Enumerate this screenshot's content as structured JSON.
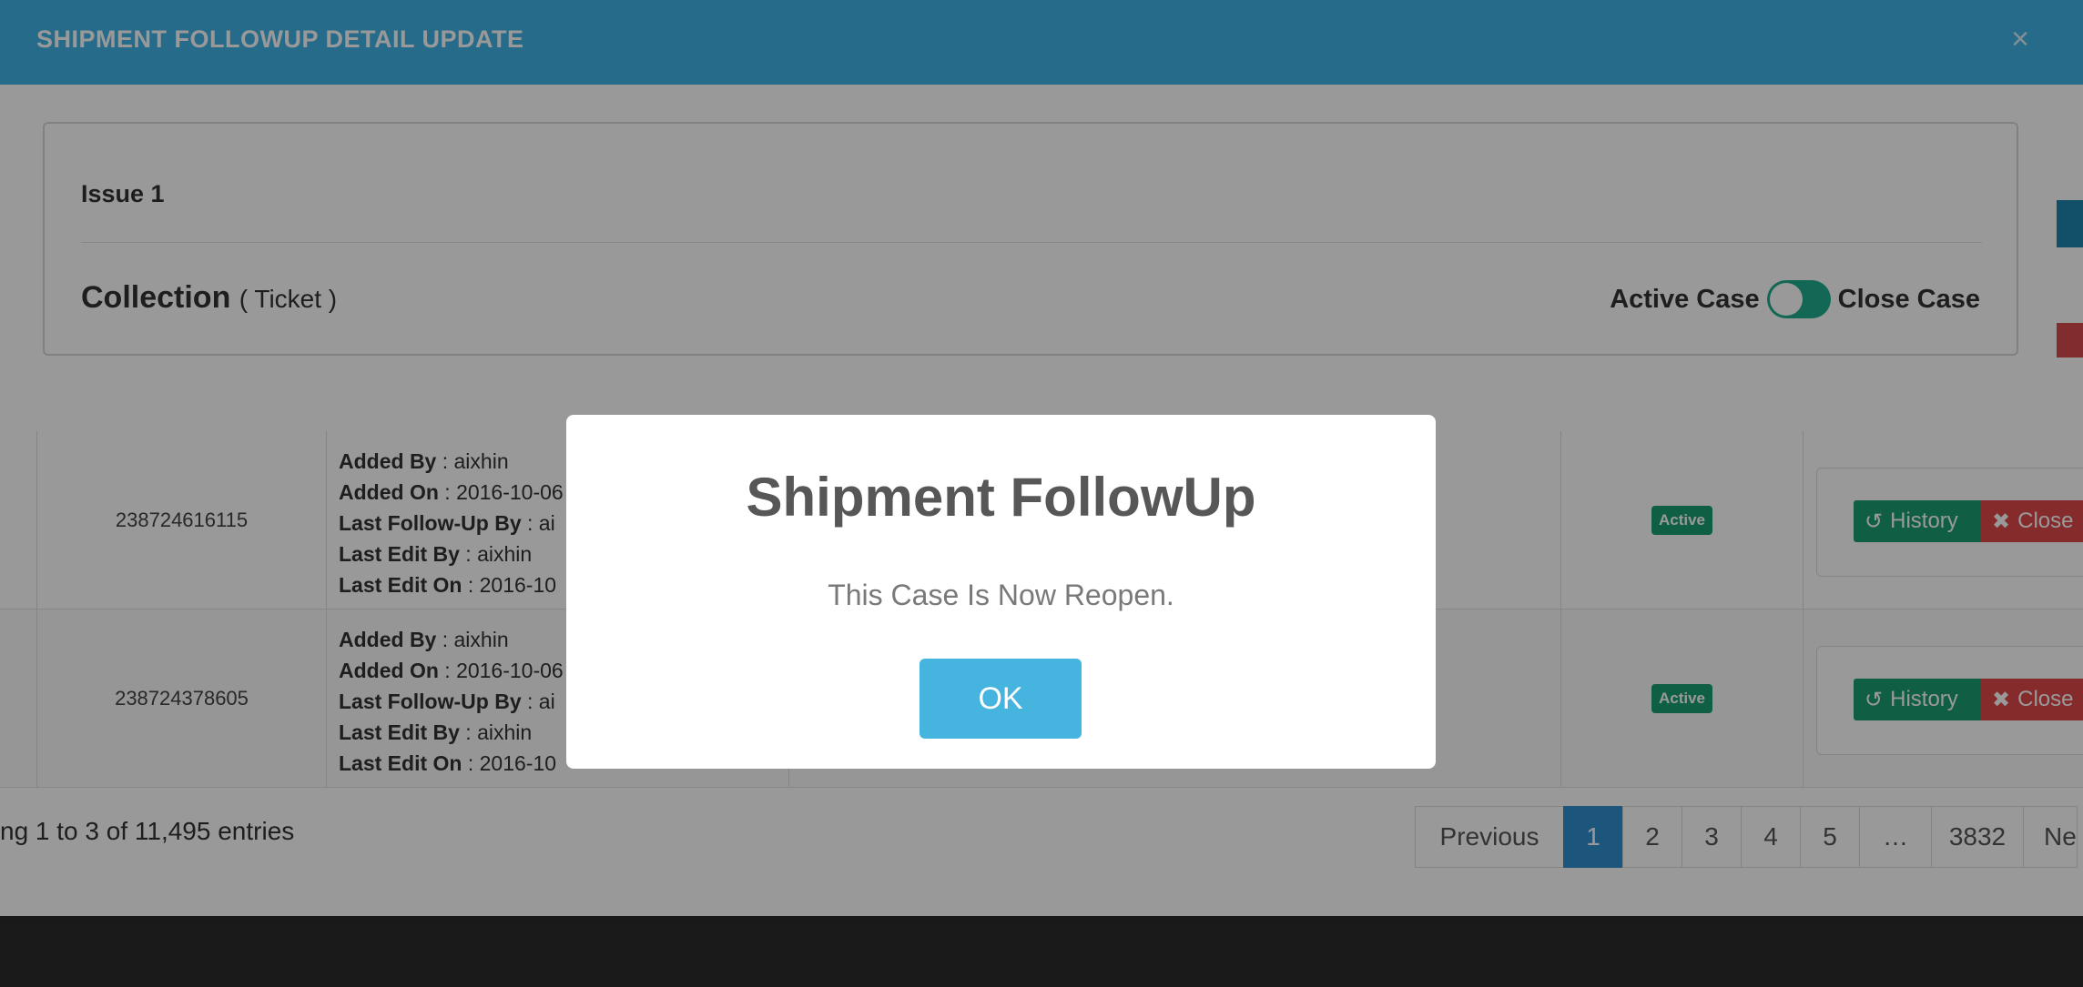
{
  "edit_modal": {
    "title": "SHIPMENT FOLLOWUP DETAIL UPDATE",
    "close_glyph": "×",
    "issue_label": "Issue 1",
    "category": "Collection",
    "category_sub": "( Ticket )",
    "toggle": {
      "left_label": "Active Case",
      "right_label": "Close Case",
      "state": "active"
    }
  },
  "table": {
    "rows": [
      {
        "tracking": "238724616115",
        "added_by_label": "Added By",
        "added_by": "aixhin",
        "added_on_label": "Added On",
        "added_on": "2016-10-06",
        "last_followup_label": "Last Follow-Up By",
        "last_followup": "ai",
        "last_edit_by_label": "Last Edit By",
        "last_edit_by": "aixhin",
        "last_edit_on_label": "Last Edit On",
        "last_edit_on": "2016-10",
        "status": "Active",
        "history_label": "History",
        "close_label": "Close"
      },
      {
        "tracking": "238724378605",
        "added_by_label": "Added By",
        "added_by": "aixhin",
        "added_on_label": "Added On",
        "added_on": "2016-10-06",
        "last_followup_label": "Last Follow-Up By",
        "last_followup": "ai",
        "last_edit_by_label": "Last Edit By",
        "last_edit_by": "aixhin",
        "last_edit_on_label": "Last Edit On",
        "last_edit_on": "2016-10",
        "status": "Active",
        "history_label": "History",
        "close_label": "Close"
      }
    ],
    "entries_info": "ng 1 to 3 of 11,495 entries",
    "pagination": {
      "previous": "Previous",
      "pages": [
        "1",
        "2",
        "3",
        "4",
        "5",
        "…",
        "3832"
      ],
      "active_page": "1",
      "next": "Ne"
    }
  },
  "alert": {
    "title": "Shipment FollowUp",
    "message": "This Case Is Now Reopen.",
    "ok_label": "OK"
  },
  "colors": {
    "header_blue": "#40b2e4",
    "toggle_green": "#1fae8c",
    "ok_blue": "#45b4de",
    "history_green": "#1b9e74",
    "close_red": "#e04848",
    "pagination_active": "#2f8fd0"
  },
  "icons": {
    "history": "history-icon",
    "close": "times-icon",
    "modal_close": "close-icon"
  }
}
